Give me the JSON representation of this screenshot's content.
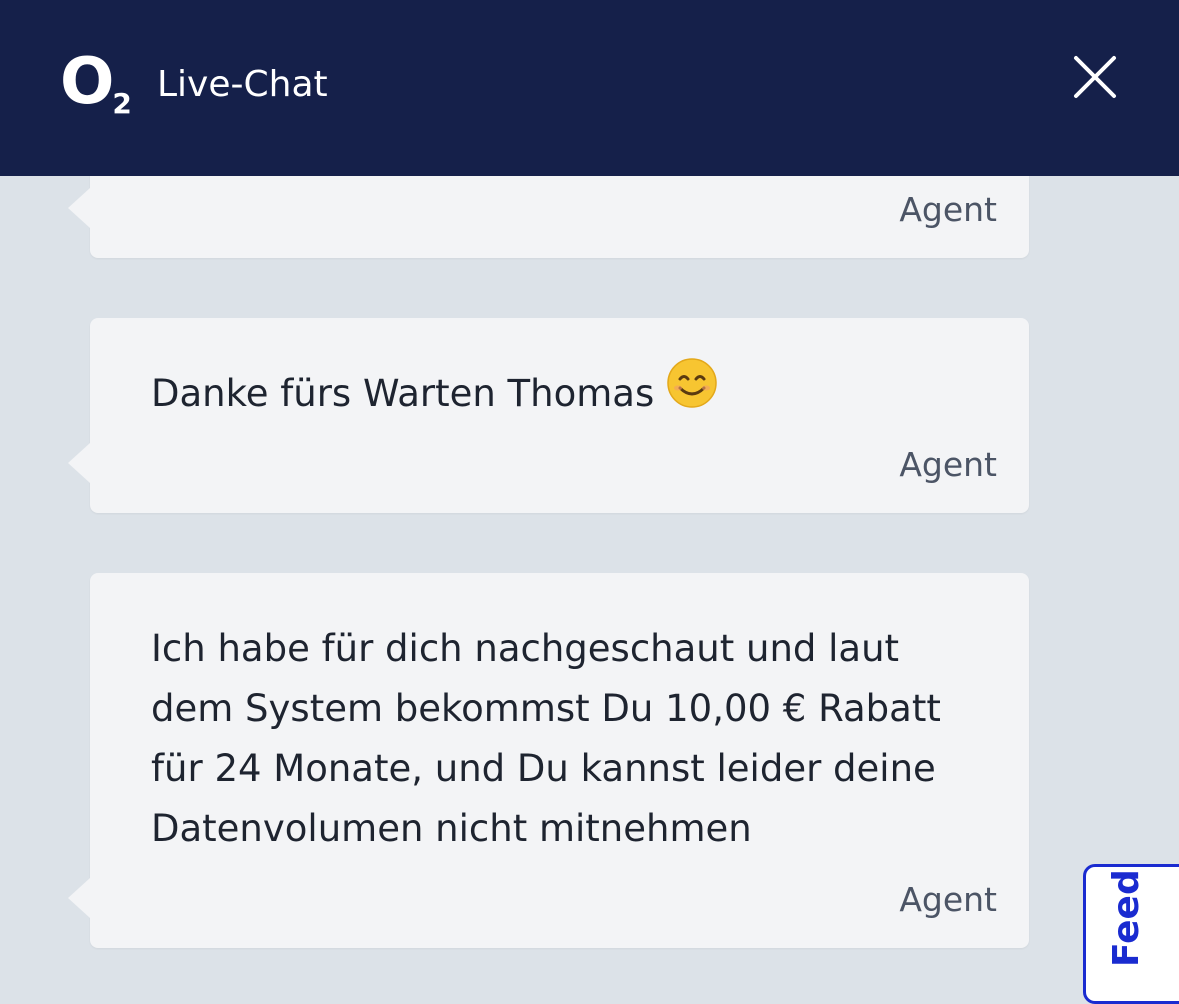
{
  "header": {
    "logo_main": "O",
    "logo_sub": "2",
    "title": "Live-Chat",
    "close_icon": "close-x-icon"
  },
  "messages": [
    {
      "text": "",
      "sender": "Agent"
    },
    {
      "text": "Danke fürs Warten Thomas",
      "emoji": "smiling-face-icon",
      "sender": "Agent"
    },
    {
      "text": "Ich habe für dich nachgeschaut und laut dem System bekommst Du 10,00 € Rabatt für 24 Monate, und Du kannst leider deine Datenvolumen nicht mitnehmen",
      "sender": "Agent"
    }
  ],
  "feedback": {
    "label": "Feedback"
  },
  "colors": {
    "header_bg": "#15204a",
    "chat_bg": "#dce2e8",
    "bubble_bg": "#f3f4f6",
    "feedback_accent": "#1a2bd0"
  }
}
